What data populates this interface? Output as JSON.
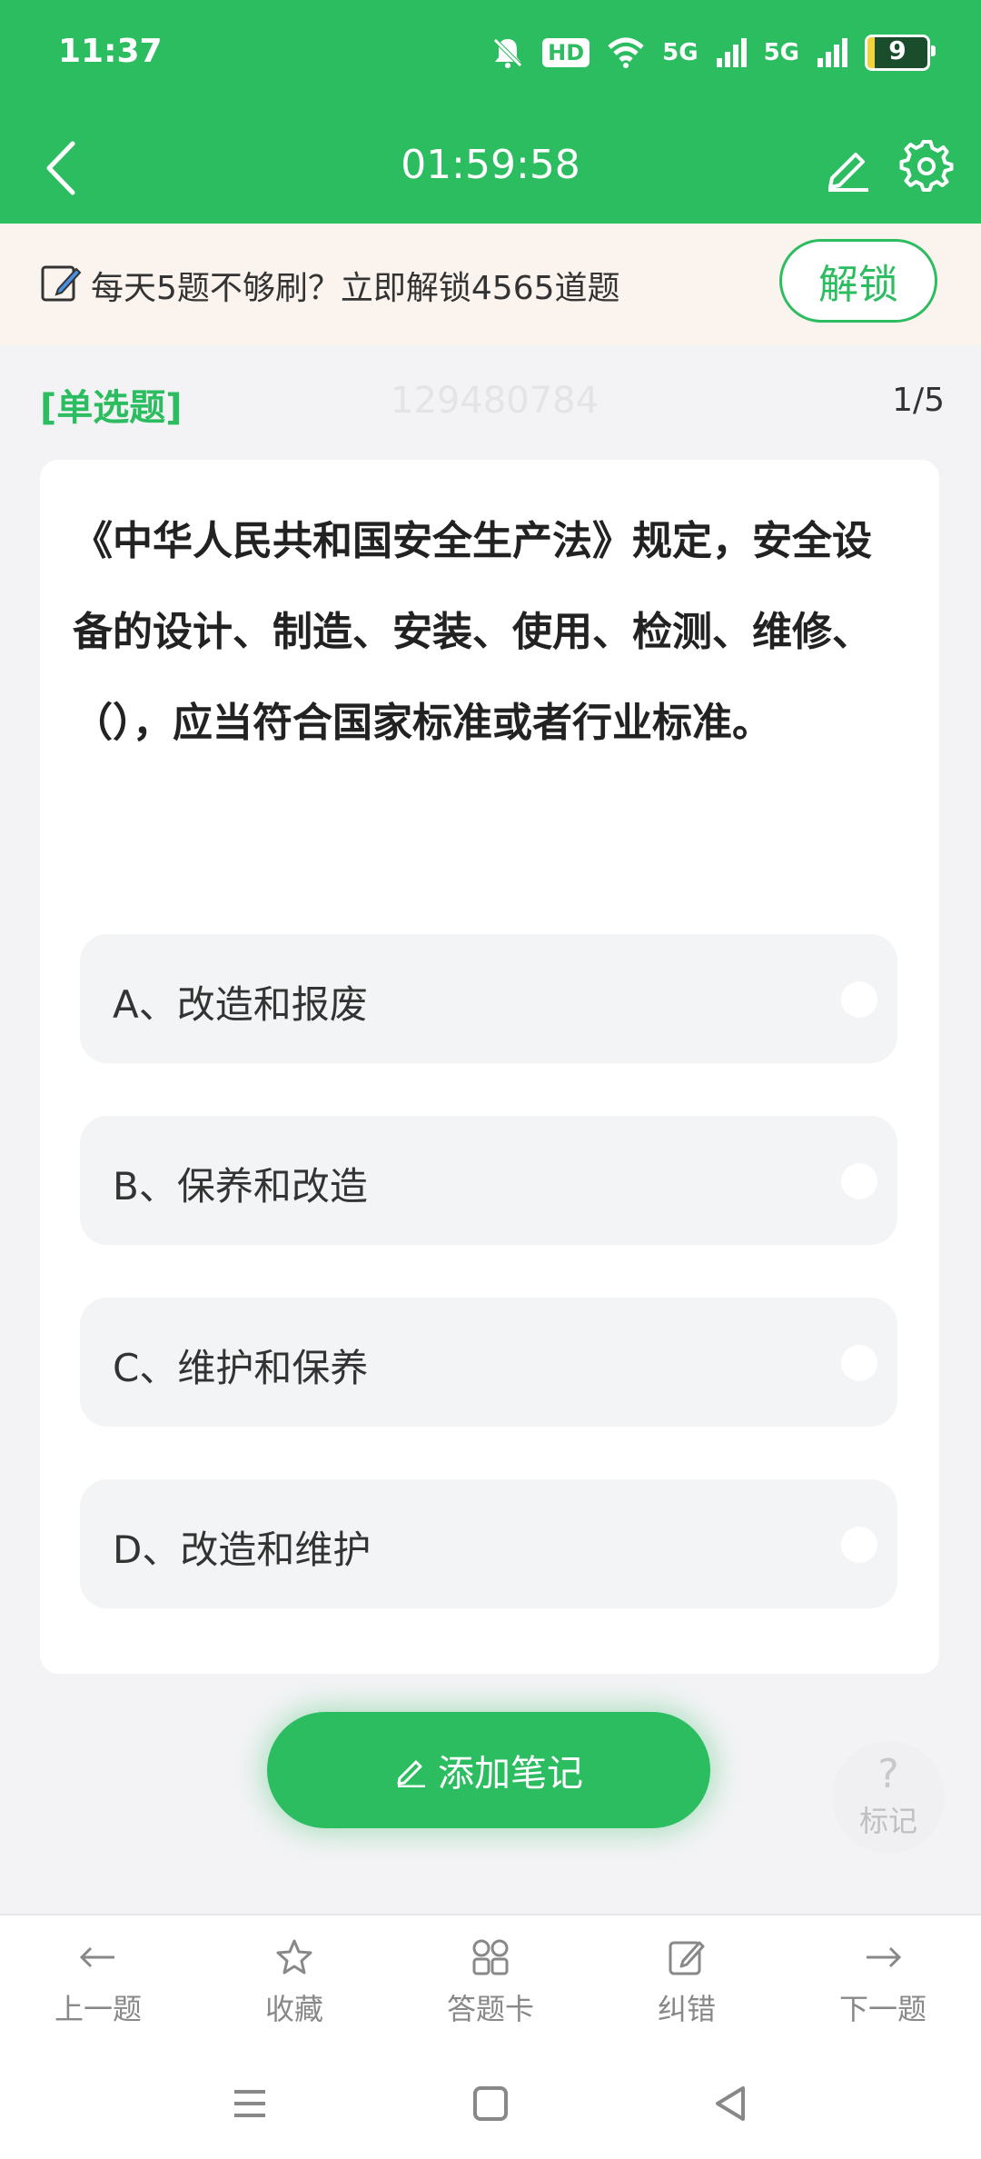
{
  "status_bar": {
    "time": "11:37",
    "network_label": "HD",
    "signal1_label": "5G",
    "signal2_label": "5G",
    "battery": "9"
  },
  "header": {
    "timer": "01:59:58",
    "icons": [
      "back-arrow-icon",
      "pencil-icon",
      "gear-icon"
    ]
  },
  "banner": {
    "text": "每天5题不够刷？立即解锁4565道题",
    "unlock_label": "解锁"
  },
  "question": {
    "type_label": "[单选题]",
    "watermark": "129480784",
    "progress": "1/5",
    "text": "《中华人民共和国安全生产法》规定，安全设备的设计、制造、安装、使用、检测、维修、（），应当符合国家标准或者行业标准。",
    "options": [
      {
        "label": "A、改造和报废"
      },
      {
        "label": "B、保养和改造"
      },
      {
        "label": "C、维护和保养"
      },
      {
        "label": "D、改造和维护"
      }
    ]
  },
  "actions": {
    "add_note_label": "添加笔记",
    "mark_label": "标记",
    "mark_symbol": "?"
  },
  "bottom_nav": {
    "items": [
      {
        "label": "上一题",
        "icon": "arrow-left-icon"
      },
      {
        "label": "收藏",
        "icon": "star-icon"
      },
      {
        "label": "答题卡",
        "icon": "grid-icon"
      },
      {
        "label": "纠错",
        "icon": "edit-icon"
      },
      {
        "label": "下一题",
        "icon": "arrow-right-icon"
      }
    ]
  },
  "colors": {
    "primary_green": "#2dbd61",
    "banner_bg": "#fbf3ee",
    "page_bg": "#f3f3f5"
  }
}
